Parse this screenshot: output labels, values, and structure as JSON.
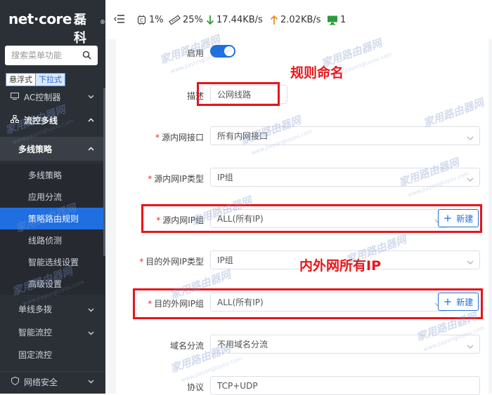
{
  "sidebar": {
    "logo_text": "net·core",
    "logo_cn": "磊科",
    "logo_reg": "®",
    "search_placeholder": "搜索菜单功能",
    "modes": [
      "悬浮式",
      "下拉式"
    ],
    "items": [
      {
        "label": "AC控制器",
        "level": 1
      },
      {
        "label": "流控多线",
        "level": 1
      },
      {
        "label": "多线策略",
        "level": 2
      },
      {
        "label": "多线策略",
        "level": 3
      },
      {
        "label": "应用分流",
        "level": 3
      },
      {
        "label": "策略路由规则",
        "level": 3,
        "active": true
      },
      {
        "label": "线路侦测",
        "level": 3
      },
      {
        "label": "智能选线设置",
        "level": 3
      },
      {
        "label": "高级设置",
        "level": 3
      },
      {
        "label": "单线多拨",
        "level": 2
      },
      {
        "label": "智能流控",
        "level": 2
      },
      {
        "label": "固定流控",
        "level": 2
      },
      {
        "label": "网络安全",
        "level": 1
      }
    ]
  },
  "topbar": {
    "cpu": "1%",
    "mem": "25%",
    "down": "17.44KB/s",
    "up": "2.02KB/s",
    "devices": "1"
  },
  "form": {
    "enable_label": "启用",
    "desc_label": "描述",
    "desc_value": "公网线路",
    "src_if_label": "源内网接口",
    "src_if_value": "所有内网接口",
    "src_ip_type_label": "源内网IP类型",
    "src_ip_type_value": "IP组",
    "src_ip_group_label": "源内网IP组",
    "src_ip_group_value": "ALL(所有IP)",
    "dst_ip_type_label": "目的外网IP类型",
    "dst_ip_type_value": "IP组",
    "dst_ip_group_label": "目的外网IP组",
    "dst_ip_group_value": "ALL(所有IP)",
    "domain_label": "域名分流",
    "domain_value": "不用域名分流",
    "protocol_label": "协议",
    "protocol_value": "TCP+UDP",
    "new_button": "新建"
  },
  "annotations": {
    "rule_name": "规则命名",
    "all_ip": "内外网所有IP"
  },
  "watermark": {
    "text": "家用路由器网",
    "url": "www.jiayongluyou.com"
  },
  "colors": {
    "accent": "#1f6fe0",
    "annotation_red": "#e8141a",
    "sidebar_bg": "#2b2f36"
  }
}
